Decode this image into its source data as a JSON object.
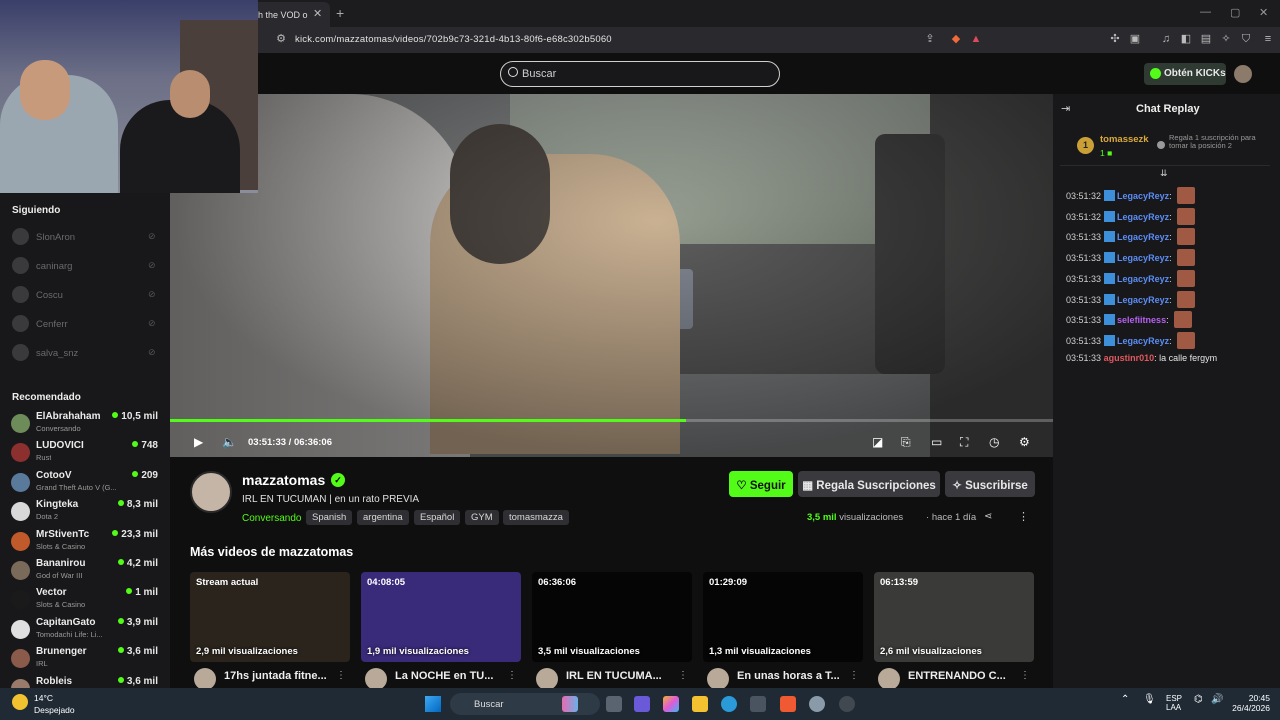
{
  "browser": {
    "tab_title": "h the VOD o",
    "url": "kick.com/mazzatomas/videos/702b9c73-321d-4b13-80f6-e68c302b5060"
  },
  "header": {
    "search_placeholder": "Buscar",
    "kicks_label": "Obtén KICKs"
  },
  "sidebar": {
    "following_heading": "Siguiendo",
    "following": [
      {
        "name": "SlonAron"
      },
      {
        "name": "caninarg"
      },
      {
        "name": "Coscu"
      },
      {
        "name": "Cenferr"
      },
      {
        "name": "salva_snz"
      }
    ],
    "recommended_heading": "Recomendado",
    "recommended": [
      {
        "name": "ElAbrahaham",
        "category": "Conversando",
        "viewers": "10,5 mil",
        "color": "#6d8c5a"
      },
      {
        "name": "LUDOVICI",
        "category": "Rust",
        "viewers": "748",
        "color": "#8c2f2f"
      },
      {
        "name": "CotooV",
        "category": "Grand Theft Auto V (G...",
        "viewers": "209",
        "color": "#5a7a9c"
      },
      {
        "name": "Kingteka",
        "category": "Dota 2",
        "viewers": "8,3 mil",
        "color": "#d8d8d8"
      },
      {
        "name": "MrStivenTc",
        "category": "Slots & Casino",
        "viewers": "23,3 mil",
        "color": "#c05a2a"
      },
      {
        "name": "Bananirou",
        "category": "God of War III",
        "viewers": "4,2 mil",
        "color": "#7a6a5a"
      },
      {
        "name": "Vector",
        "category": "Slots & Casino",
        "viewers": "1 mil",
        "color": "#1a1a1a"
      },
      {
        "name": "CapitanGato",
        "category": "Tomodachi Life: Li...",
        "viewers": "3,9 mil",
        "color": "#e0e0e0"
      },
      {
        "name": "Brunenger",
        "category": "IRL",
        "viewers": "3,6 mil",
        "color": "#8a5a4a"
      },
      {
        "name": "Robleis",
        "category": "",
        "viewers": "3,6 mil",
        "color": "#9a7a6a"
      }
    ]
  },
  "player": {
    "time_current": "03:51:33",
    "time_total": "06:36:06",
    "progress": 0.584
  },
  "channel": {
    "name": "mazzatomas",
    "title": "IRL EN TUCUMAN | en un rato PREVIA",
    "category": "Conversando",
    "tags": [
      "Spanish",
      "argentina",
      "Español",
      "GYM",
      "tomasmazza"
    ],
    "follow_label": "Seguir",
    "gift_label": "Regala Suscripciones",
    "subscribe_label": "Suscribirse",
    "views_number": "3,5 mil",
    "views_word": "visualizaciones",
    "ago": "hace 1 día"
  },
  "more_videos": {
    "heading": "Más videos de mazzatomas",
    "items": [
      {
        "label": "Stream actual",
        "views": "2,9 mil visualizaciones",
        "title": "17hs juntada fitne...",
        "bg": "#2a241c"
      },
      {
        "label": "04:08:05",
        "views": "1,9 mil visualizaciones",
        "title": "La NOCHE en TU...",
        "bg": "#3a2a7a"
      },
      {
        "label": "06:36:06",
        "views": "3,5 mil visualizaciones",
        "title": "IRL EN TUCUMA...",
        "bg": "#050505"
      },
      {
        "label": "01:29:09",
        "views": "1,3 mil visualizaciones",
        "title": "En unas horas a T...",
        "bg": "#050505"
      },
      {
        "label": "06:13:59",
        "views": "2,6 mil visualizaciones",
        "title": "ENTRENANDO C...",
        "bg": "#3a3a38"
      }
    ]
  },
  "chat": {
    "title": "Chat Replay",
    "pinned_user": "tomassezk",
    "pinned_badge": "1",
    "pinned_count": "1",
    "pinned_text": "Regala 1 suscripción para tomar la posición 2",
    "messages": [
      {
        "time": "03:51:32",
        "user": "LegacyReyz",
        "color": "#5b8df5",
        "text": ""
      },
      {
        "time": "03:51:32",
        "user": "LegacyReyz",
        "color": "#5b8df5",
        "text": ""
      },
      {
        "time": "03:51:33",
        "user": "LegacyReyz",
        "color": "#5b8df5",
        "text": ""
      },
      {
        "time": "03:51:33",
        "user": "LegacyReyz",
        "color": "#5b8df5",
        "text": ""
      },
      {
        "time": "03:51:33",
        "user": "LegacyReyz",
        "color": "#5b8df5",
        "text": ""
      },
      {
        "time": "03:51:33",
        "user": "LegacyReyz",
        "color": "#5b8df5",
        "text": ""
      },
      {
        "time": "03:51:33",
        "user": "selefiitness",
        "color": "#b560f0",
        "text": ""
      },
      {
        "time": "03:51:33",
        "user": "LegacyReyz",
        "color": "#5b8df5",
        "text": ""
      },
      {
        "time": "03:51:33",
        "user": "agustinr010",
        "color": "#e0595f",
        "text": "la calle fergym"
      }
    ]
  },
  "taskbar": {
    "temperature": "14°C",
    "weather": "Despejado",
    "search_label": "Buscar",
    "lang_1": "ESP",
    "lang_2": "LAA",
    "time": "20:45",
    "date": "26/4/2026"
  }
}
